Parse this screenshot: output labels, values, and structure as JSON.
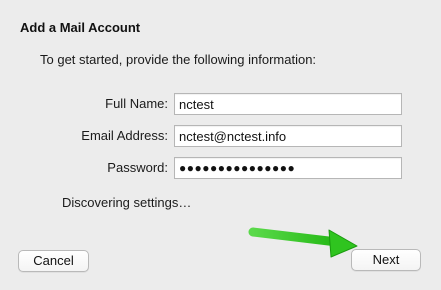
{
  "dialog": {
    "title": "Add a Mail Account",
    "intro": "To get started, provide the following information:",
    "fields": [
      {
        "label": "Full Name:",
        "value": "nctest"
      },
      {
        "label": "Email Address:",
        "value": "nctest@nctest.info"
      },
      {
        "label": "Password:",
        "value": "●●●●●●●●●●●●●●●"
      }
    ],
    "status": "Discovering settings…",
    "cancel_label": "Cancel",
    "next_label": "Next"
  },
  "annotation": {
    "icon": "arrow-pointer-icon",
    "color": "#2fc41f"
  }
}
